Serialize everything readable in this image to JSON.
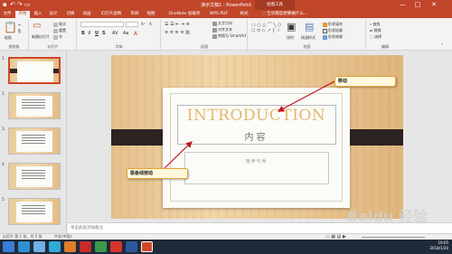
{
  "window": {
    "title": "演示文稿1 - PowerPoint",
    "context_tab_group": "绘图工具",
    "quick_access": [
      "↶",
      "↷"
    ],
    "controls": [
      "—",
      "□",
      "✕"
    ]
  },
  "ribbon_tabs": [
    "文件",
    "开始",
    "插入",
    "设计",
    "切换",
    "动画",
    "幻灯片放映",
    "审阅",
    "视图",
    "OneNote 加载项",
    "WPS PDF",
    "格式"
  ],
  "active_tab": "开始",
  "tell_me": "告诉我您想要做什么...",
  "ribbon": {
    "clipboard": {
      "paste": "粘贴",
      "label": "剪贴板"
    },
    "slides": {
      "new_slide": "新建幻灯片",
      "layout": "版式",
      "reset": "重置",
      "section": "节",
      "label": "幻灯片"
    },
    "font": {
      "font_name": "",
      "font_size": "",
      "bold": "B",
      "italic": "I",
      "underline": "U",
      "strike": "S",
      "label": "字体"
    },
    "paragraph": {
      "text_direction": "文字方向",
      "align_text": "对齐文本",
      "smartart": "转换为 SmartArt",
      "label": "段落"
    },
    "drawing": {
      "arrange": "排列",
      "quick_styles": "快速样式",
      "shape_fill": "形状填充",
      "shape_outline": "形状轮廓",
      "shape_effects": "形状效果",
      "label": "绘图"
    },
    "editing": {
      "find": "查找",
      "replace": "替换",
      "select": "选择",
      "label": "编辑"
    }
  },
  "thumbnails": [
    "1",
    "2",
    "3",
    "4",
    "5"
  ],
  "slide": {
    "title_en": "INTRODUCTION",
    "title_cn": "内容",
    "author": "施伊与骨"
  },
  "callouts": {
    "move": "移动",
    "guide_move": "极板线按动"
  },
  "notes_placeholder": "单击此处添加备注",
  "status": {
    "slide_info": "幻灯片 第 1 张，共 5 张",
    "language": "中文(中国)"
  },
  "taskbar": {
    "time": "19:05",
    "date": "2018/1/20"
  },
  "watermark": "Baidu 经验"
}
